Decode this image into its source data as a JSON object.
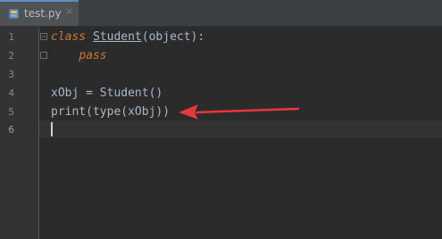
{
  "tab": {
    "filename": "test.py",
    "close_glyph": "×",
    "icon": "python-file-icon"
  },
  "gutter": {
    "line_numbers": [
      "1",
      "2",
      "3",
      "4",
      "5",
      "6"
    ],
    "current_line": 6
  },
  "code": {
    "line1": {
      "keyword": "class",
      "space": " ",
      "class_name": "Student",
      "rest": "(object):"
    },
    "line2": {
      "indent": "    ",
      "keyword": "pass"
    },
    "line4": {
      "text": "xObj = Student()"
    },
    "line5": {
      "text": "print(type(xObj))"
    }
  },
  "annotation": {
    "arrow_color": "#e8373a",
    "points_to_line": 5
  },
  "colors": {
    "editor_bg": "#2b2b2b",
    "keyword": "#cc7832",
    "text": "#a9b7c6",
    "gutter_bg": "#313335"
  }
}
